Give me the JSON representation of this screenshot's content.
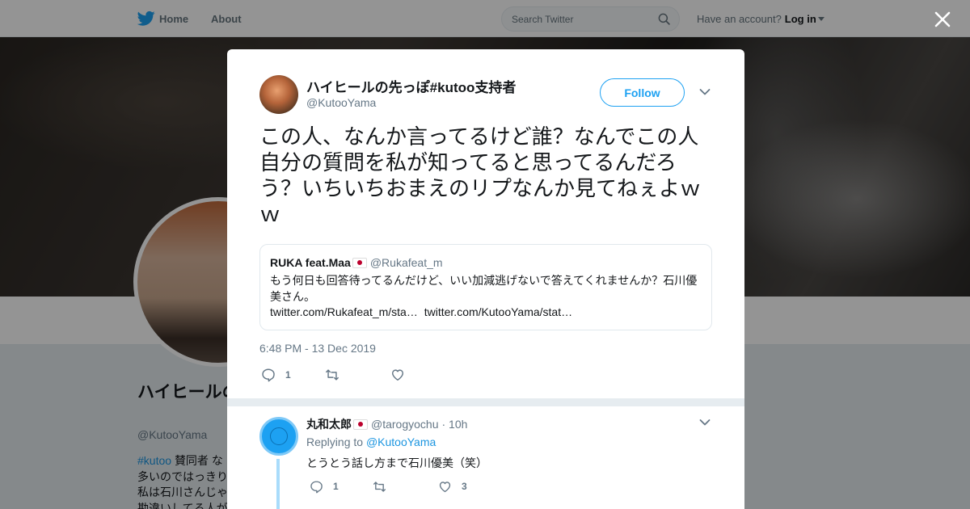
{
  "topbar": {
    "nav": [
      "Home",
      "About"
    ],
    "search_placeholder": "Search Twitter",
    "account_prompt": "Have an account?",
    "login_label": "Log in"
  },
  "profile": {
    "name": "ハイヒールの先っぽ#kutoo支持者",
    "handle": "@KutooYama",
    "bio_tag": "#kutoo",
    "bio": "賛同者 な\n多いのではっきり\n私は石川さんじゃ\n勘違いしてる人が"
  },
  "tweet": {
    "author_name": "ハイヒールの先っぽ#kutoo支持者",
    "author_handle": "@KutooYama",
    "follow_label": "Follow",
    "text": "この人、なんか言ってるけど誰？なんでこの人自分の質問を私が知ってると思ってるんだろう？いちいちおまえのリプなんか見てねぇよｗｗ",
    "quote": {
      "name": "RUKA feat.Maa",
      "handle": "@Rukafeat_m",
      "text": "もう何日も回答待ってるんだけど、いい加減逃げないで答えてくれませんか？石川優美さん。",
      "link1": "twitter.com/Rukafeat_m/sta…",
      "link2": "twitter.com/KutooYama/stat…"
    },
    "timestamp": "6:48 PM - 13 Dec 2019",
    "reply_count": "1",
    "retweet_count": "",
    "like_count": ""
  },
  "reply": {
    "name": "丸和太郎",
    "handle": "@tarogyochu",
    "age": "· 10h",
    "replying_to_prefix": "Replying to",
    "replying_to": "@KutooYama",
    "text": "とうとう話し方まで石川優美（笑）",
    "reply_count": "1",
    "retweet_count": "",
    "like_count": "3"
  },
  "colors": {
    "accent": "#1da1f2",
    "link": "#1b95e0",
    "muted": "#657786",
    "flag_red": "#bc002d"
  },
  "icons": [
    "twitter-bird-icon",
    "search-icon",
    "close-icon",
    "chevron-down-icon",
    "reply-icon",
    "retweet-icon",
    "heart-icon",
    "japan-flag-icon"
  ]
}
